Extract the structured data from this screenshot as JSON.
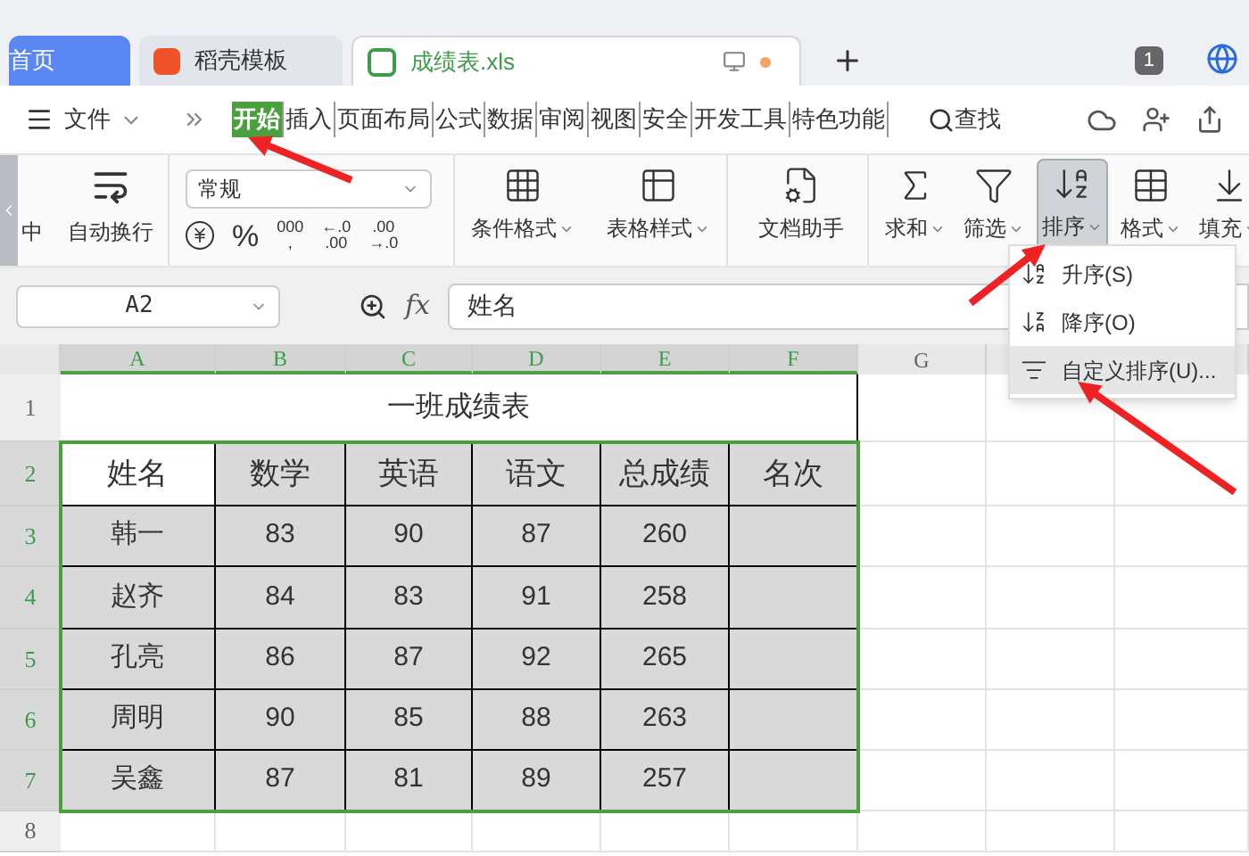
{
  "tabs": [
    {
      "label": "首页",
      "kind": "home",
      "selected": false
    },
    {
      "label": "稻壳模板",
      "kind": "template",
      "selected": false
    },
    {
      "label": "成绩表.xls",
      "kind": "file",
      "selected": true
    }
  ],
  "window_badge": "1",
  "menu": {
    "file": "文件",
    "items": [
      {
        "label": "开始",
        "selected": true
      },
      {
        "label": "插入",
        "selected": false
      },
      {
        "label": "页面布局",
        "selected": false
      },
      {
        "label": "公式",
        "selected": false
      },
      {
        "label": "数据",
        "selected": false
      },
      {
        "label": "审阅",
        "selected": false
      },
      {
        "label": "视图",
        "selected": false
      },
      {
        "label": "安全",
        "selected": false
      },
      {
        "label": "开发工具",
        "selected": false
      },
      {
        "label": "特色功能",
        "selected": false
      }
    ],
    "search": "查找"
  },
  "ribbon": {
    "cut_label": "中",
    "wrap_label": "自动换行",
    "number_format": "常规",
    "percent": "%",
    "thousands": [
      "000",
      ","
    ],
    "add_decimal": [
      "←.0",
      ".00"
    ],
    "remove_decimal": [
      ".00",
      "→.0"
    ],
    "tools": [
      {
        "label": "条件格式",
        "selected": false,
        "dropdown": true
      },
      {
        "label": "表格样式",
        "selected": false,
        "dropdown": true
      },
      {
        "label": "文档助手",
        "selected": false,
        "dropdown": false
      },
      {
        "label": "求和",
        "selected": false,
        "dropdown": true
      },
      {
        "label": "筛选",
        "selected": false,
        "dropdown": true
      },
      {
        "label": "排序",
        "selected": true,
        "dropdown": true
      },
      {
        "label": "格式",
        "selected": false,
        "dropdown": true
      },
      {
        "label": "填充",
        "selected": false,
        "dropdown": true
      }
    ]
  },
  "sort_menu": [
    {
      "label": "升序(S)",
      "selected": false
    },
    {
      "label": "降序(O)",
      "selected": false
    },
    {
      "label": "自定义排序(U)...",
      "selected": true
    }
  ],
  "formula_bar": {
    "cell": "A2",
    "fx": "fx",
    "value": "姓名"
  },
  "sheet": {
    "columns": [
      {
        "label": "A",
        "selected": true
      },
      {
        "label": "B",
        "selected": true
      },
      {
        "label": "C",
        "selected": true
      },
      {
        "label": "D",
        "selected": true
      },
      {
        "label": "E",
        "selected": true
      },
      {
        "label": "F",
        "selected": true
      },
      {
        "label": "G",
        "selected": false
      }
    ],
    "row_numbers": [
      {
        "label": "1",
        "selected": false
      },
      {
        "label": "2",
        "selected": true
      },
      {
        "label": "3",
        "selected": true
      },
      {
        "label": "4",
        "selected": true
      },
      {
        "label": "5",
        "selected": true
      },
      {
        "label": "6",
        "selected": true
      },
      {
        "label": "7",
        "selected": true
      },
      {
        "label": "8",
        "selected": false
      }
    ],
    "title": "一班成绩表",
    "header": [
      "姓名",
      "数学",
      "英语",
      "语文",
      "总成绩",
      "名次"
    ],
    "rows": [
      [
        "韩一",
        "83",
        "90",
        "87",
        "260"
      ],
      [
        "赵齐",
        "84",
        "83",
        "91",
        "258"
      ],
      [
        "孔亮",
        "86",
        "87",
        "92",
        "265"
      ],
      [
        "周明",
        "90",
        "85",
        "88",
        "263"
      ],
      [
        "吴鑫",
        "87",
        "81",
        "89",
        "257"
      ]
    ]
  }
}
